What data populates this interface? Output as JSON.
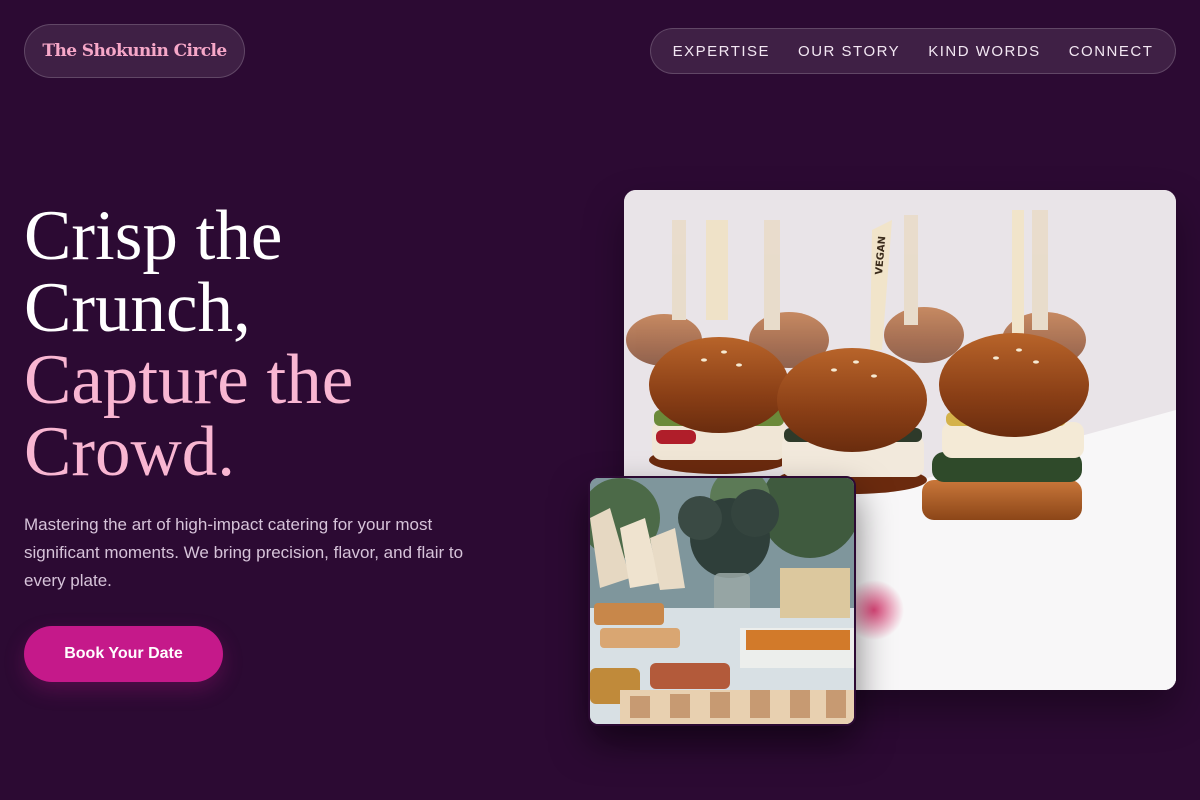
{
  "brand": {
    "name": "The Shokunin Circle"
  },
  "nav": {
    "items": [
      {
        "label": "EXPERTISE"
      },
      {
        "label": "OUR STORY"
      },
      {
        "label": "KIND WORDS"
      },
      {
        "label": "CONNECT"
      }
    ]
  },
  "hero": {
    "headline_line1": "Crisp the",
    "headline_line2": "Crunch,",
    "headline_line3": "Capture the",
    "headline_line4": "Crowd.",
    "description": "Mastering the art of high-impact catering for your most significant moments. We bring precision, flavor, and flair to every plate.",
    "cta_label": "Book Your Date"
  },
  "images": {
    "main_photo": "sliders-photo",
    "main_photo_pick_label": "VEGAN",
    "secondary_photo": "buffet-table-photo"
  },
  "colors": {
    "background": "#2c0a33",
    "accent_pink": "#f9b6d2",
    "logo_pink": "#f6a7c8",
    "cta": "#c5198a"
  }
}
